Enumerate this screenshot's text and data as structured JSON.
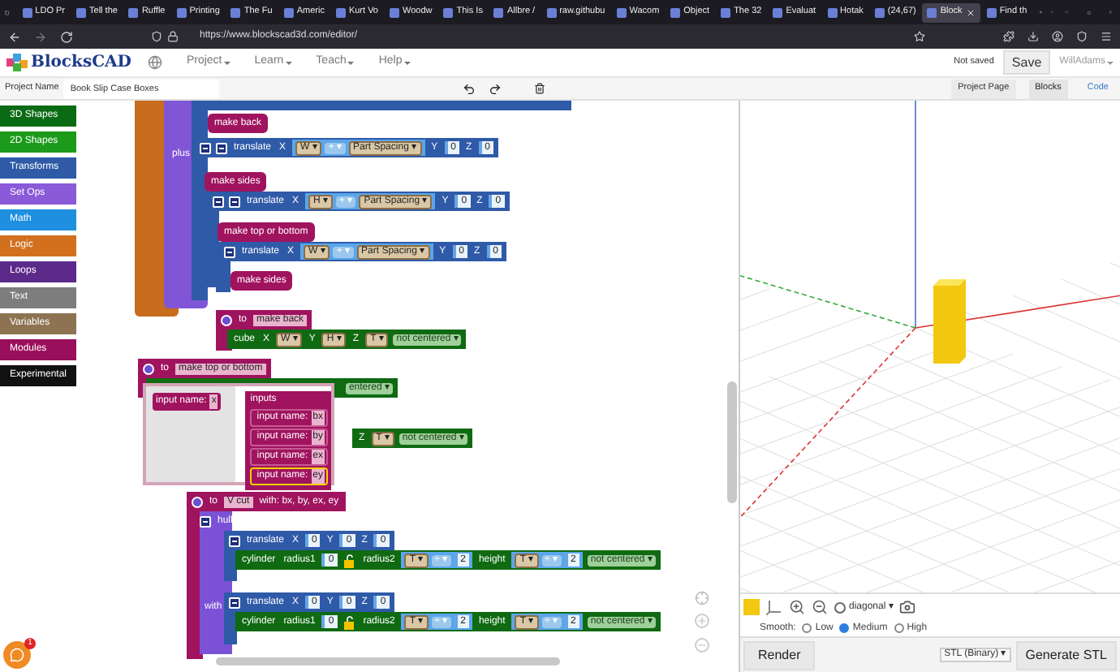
{
  "browser": {
    "tabs": [
      {
        "label": "LDO Pr",
        "selected": false
      },
      {
        "label": "Tell the",
        "selected": false
      },
      {
        "label": "Ruffle",
        "selected": false
      },
      {
        "label": "Printing",
        "selected": false
      },
      {
        "label": "The Fu",
        "selected": false
      },
      {
        "label": "Americ",
        "selected": false
      },
      {
        "label": "Kurt Vo",
        "selected": false
      },
      {
        "label": "Woodw",
        "selected": false
      },
      {
        "label": "This Is",
        "selected": false
      },
      {
        "label": "Allbre /",
        "selected": false
      },
      {
        "label": "raw.githubu",
        "selected": false
      },
      {
        "label": "Wacom",
        "selected": false
      },
      {
        "label": "Object",
        "selected": false
      },
      {
        "label": "The 32",
        "selected": false
      },
      {
        "label": "Evaluat",
        "selected": false
      },
      {
        "label": "Hotak",
        "selected": false
      },
      {
        "label": "(24,67)",
        "selected": false
      },
      {
        "label": "Block",
        "selected": true
      },
      {
        "label": "Find th",
        "selected": false
      }
    ],
    "url": "https://www.blockscad3d.com/editor/"
  },
  "header": {
    "brand": "BlocksCAD",
    "menus": [
      "Project",
      "Learn",
      "Teach",
      "Help"
    ],
    "status": "Not saved",
    "save": "Save",
    "user": "WillAdams"
  },
  "project": {
    "label": "Project Name",
    "value": "Book Slip Case Boxes",
    "page_button": "Project Page",
    "views": [
      {
        "label": "Blocks",
        "selected": true
      },
      {
        "label": "Code",
        "selected": false
      }
    ]
  },
  "categories": [
    {
      "label": "3D Shapes",
      "color": "#0b6b14"
    },
    {
      "label": "2D Shapes",
      "color": "#1b9a1b"
    },
    {
      "label": "Transforms",
      "color": "#2e5aa6"
    },
    {
      "label": "Set Ops",
      "color": "#8a5ad8"
    },
    {
      "label": "Math",
      "color": "#1f8fe0"
    },
    {
      "label": "Logic",
      "color": "#d2701e"
    },
    {
      "label": "Loops",
      "color": "#5c2a8a"
    },
    {
      "label": "Text",
      "color": "#7d7d7d"
    },
    {
      "label": "Variables",
      "color": "#8d7352"
    },
    {
      "label": "Modules",
      "color": "#9a0f5c"
    },
    {
      "label": "Experimental",
      "color": "#111111"
    }
  ],
  "canvas": {
    "rows": [
      {
        "kind": "call",
        "parts": [
          {
            "kind": "label",
            "text": "make back"
          }
        ]
      },
      {
        "kind": "bare",
        "parts": [
          {
            "kind": "label",
            "text": "plus"
          }
        ]
      },
      {
        "kind": "transform",
        "parts": [
          {
            "kind": "toggle"
          },
          {
            "kind": "toggle"
          },
          {
            "kind": "label",
            "text": "translate"
          },
          {
            "kind": "label",
            "text": "X"
          },
          {
            "kind": "expr",
            "parts": [
              {
                "kind": "var",
                "text": "W ▾"
              },
              {
                "kind": "op",
                "text": "+ ▾"
              },
              {
                "kind": "var",
                "text": "Part Spacing ▾"
              }
            ]
          },
          {
            "kind": "label",
            "text": "Y"
          },
          {
            "kind": "num",
            "text": "0"
          },
          {
            "kind": "label",
            "text": "Z"
          },
          {
            "kind": "num",
            "text": "0"
          }
        ]
      },
      {
        "kind": "call",
        "parts": [
          {
            "kind": "label",
            "text": "make sides"
          }
        ]
      },
      {
        "kind": "transform",
        "parts": [
          {
            "kind": "toggle"
          },
          {
            "kind": "toggle"
          },
          {
            "kind": "label",
            "text": "translate"
          },
          {
            "kind": "label",
            "text": "X"
          },
          {
            "kind": "expr",
            "parts": [
              {
                "kind": "var",
                "text": "H ▾"
              },
              {
                "kind": "op",
                "text": "+ ▾"
              },
              {
                "kind": "var",
                "text": "Part Spacing ▾"
              }
            ]
          },
          {
            "kind": "label",
            "text": "Y"
          },
          {
            "kind": "num",
            "text": "0"
          },
          {
            "kind": "label",
            "text": "Z"
          },
          {
            "kind": "num",
            "text": "0"
          }
        ]
      },
      {
        "kind": "call",
        "parts": [
          {
            "kind": "label",
            "text": "make top or bottom"
          }
        ]
      },
      {
        "kind": "transform",
        "parts": [
          {
            "kind": "toggle"
          },
          {
            "kind": "label",
            "text": "translate"
          },
          {
            "kind": "label",
            "text": "X"
          },
          {
            "kind": "expr",
            "parts": [
              {
                "kind": "var",
                "text": "W ▾"
              },
              {
                "kind": "op",
                "text": "+ ▾"
              },
              {
                "kind": "var",
                "text": "Part Spacing ▾"
              }
            ]
          },
          {
            "kind": "label",
            "text": "Y"
          },
          {
            "kind": "num",
            "text": "0"
          },
          {
            "kind": "label",
            "text": "Z"
          },
          {
            "kind": "num",
            "text": "0"
          }
        ]
      },
      {
        "kind": "call",
        "parts": [
          {
            "kind": "label",
            "text": "make sides"
          }
        ]
      },
      {
        "kind": "def",
        "parts": [
          {
            "kind": "gear"
          },
          {
            "kind": "label",
            "text": "to"
          },
          {
            "kind": "proc",
            "text": "make back"
          }
        ]
      },
      {
        "kind": "shape",
        "parts": [
          {
            "kind": "label",
            "text": "cube"
          },
          {
            "kind": "label",
            "text": "X"
          },
          {
            "kind": "var",
            "text": "W ▾"
          },
          {
            "kind": "label",
            "text": "Y"
          },
          {
            "kind": "var",
            "text": "H ▾"
          },
          {
            "kind": "label",
            "text": "Z"
          },
          {
            "kind": "var",
            "text": "T ▾"
          },
          {
            "kind": "dropdown",
            "text": "not centered ▾"
          }
        ]
      },
      {
        "kind": "def",
        "parts": [
          {
            "kind": "gear"
          },
          {
            "kind": "label",
            "text": "to"
          },
          {
            "kind": "proc",
            "text": "make top or bottom"
          }
        ]
      },
      {
        "kind": "shape",
        "parts": [
          {
            "kind": "dropdown",
            "text": "entered ▾"
          }
        ]
      },
      {
        "kind": "shape",
        "parts": [
          {
            "kind": "label",
            "text": "Z"
          },
          {
            "kind": "var",
            "text": "T ▾"
          },
          {
            "kind": "dropdown",
            "text": "not centered ▾"
          }
        ]
      },
      {
        "kind": "def",
        "parts": [
          {
            "kind": "gear"
          },
          {
            "kind": "label",
            "text": "to"
          },
          {
            "kind": "proc",
            "text": "V cut"
          },
          {
            "kind": "label",
            "text": "with: bx, by, ex, ey"
          }
        ]
      },
      {
        "kind": "bare",
        "parts": [
          {
            "kind": "toggle"
          },
          {
            "kind": "label",
            "text": "hull"
          }
        ]
      },
      {
        "kind": "transform",
        "parts": [
          {
            "kind": "toggle"
          },
          {
            "kind": "label",
            "text": "translate"
          },
          {
            "kind": "label",
            "text": "X"
          },
          {
            "kind": "num",
            "text": "0"
          },
          {
            "kind": "label",
            "text": "Y"
          },
          {
            "kind": "num",
            "text": "0"
          },
          {
            "kind": "label",
            "text": "Z"
          },
          {
            "kind": "num",
            "text": "0"
          }
        ]
      },
      {
        "kind": "shape",
        "parts": [
          {
            "kind": "label",
            "text": "cylinder"
          },
          {
            "kind": "label",
            "text": "radius1"
          },
          {
            "kind": "num",
            "text": "0"
          },
          {
            "kind": "lock"
          },
          {
            "kind": "label",
            "text": "radius2"
          },
          {
            "kind": "expr",
            "parts": [
              {
                "kind": "var",
                "text": "T ▾"
              },
              {
                "kind": "op",
                "text": "÷ ▾"
              },
              {
                "kind": "num",
                "text": "2"
              }
            ]
          },
          {
            "kind": "label",
            "text": "height"
          },
          {
            "kind": "expr",
            "parts": [
              {
                "kind": "var",
                "text": "T ▾"
              },
              {
                "kind": "op",
                "text": "÷ ▾"
              },
              {
                "kind": "num",
                "text": "2"
              }
            ]
          },
          {
            "kind": "dropdown",
            "text": "not centered ▾"
          }
        ]
      },
      {
        "kind": "bare",
        "parts": [
          {
            "kind": "label",
            "text": "with"
          }
        ]
      },
      {
        "kind": "transform",
        "parts": [
          {
            "kind": "toggle"
          },
          {
            "kind": "label",
            "text": "translate"
          },
          {
            "kind": "label",
            "text": "X"
          },
          {
            "kind": "num",
            "text": "0"
          },
          {
            "kind": "label",
            "text": "Y"
          },
          {
            "kind": "num",
            "text": "0"
          },
          {
            "kind": "label",
            "text": "Z"
          },
          {
            "kind": "num",
            "text": "0"
          }
        ]
      },
      {
        "kind": "shape",
        "parts": [
          {
            "kind": "label",
            "text": "cylinder"
          },
          {
            "kind": "label",
            "text": "radius1"
          },
          {
            "kind": "num",
            "text": "0"
          },
          {
            "kind": "lock"
          },
          {
            "kind": "label",
            "text": "radius2"
          },
          {
            "kind": "expr",
            "parts": [
              {
                "kind": "var",
                "text": "T ▾"
              },
              {
                "kind": "op",
                "text": "÷ ▾"
              },
              {
                "kind": "num",
                "text": "2"
              }
            ]
          },
          {
            "kind": "label",
            "text": "height"
          },
          {
            "kind": "expr",
            "parts": [
              {
                "kind": "var",
                "text": "T ▾"
              },
              {
                "kind": "op",
                "text": "÷ ▾"
              },
              {
                "kind": "num",
                "text": "2"
              }
            ]
          },
          {
            "kind": "dropdown",
            "text": "not centered ▾"
          }
        ]
      }
    ],
    "mutator": {
      "param_label": "input name:",
      "param_value": "x",
      "title": "inputs",
      "items": [
        {
          "label": "input name:",
          "value": "bx",
          "selected": false
        },
        {
          "label": "input name:",
          "value": "by",
          "selected": false
        },
        {
          "label": "input name:",
          "value": "ex",
          "selected": false
        },
        {
          "label": "input name:",
          "value": "ey",
          "selected": true
        }
      ]
    }
  },
  "viewer": {
    "view": "diagonal ▾",
    "smooth_label": "Smooth:",
    "smooth": [
      {
        "label": "Low",
        "selected": false
      },
      {
        "label": "Medium",
        "selected": true
      },
      {
        "label": "High",
        "selected": false
      }
    ],
    "render": "Render",
    "format": "STL (Binary) ▾",
    "generate": "Generate STL"
  },
  "help_badge": "1"
}
